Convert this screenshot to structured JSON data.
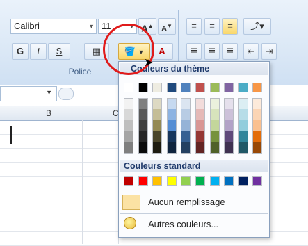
{
  "ribbon": {
    "font_name": "Calibri",
    "font_size": "11",
    "bold": "G",
    "italic": "I",
    "underline": "S",
    "group_label": "Police"
  },
  "sheet": {
    "column_b": "B",
    "column_c": "C"
  },
  "popup": {
    "theme_header": "Couleurs du thème",
    "standard_header": "Couleurs standard",
    "no_fill": "Aucun remplissage",
    "more_colors": "Autres couleurs...",
    "theme_top_row": [
      "#ffffff",
      "#000000",
      "#eeece1",
      "#1f497d",
      "#4f81bd",
      "#c0504d",
      "#9bbb59",
      "#8064a2",
      "#4bacc6",
      "#f79646"
    ],
    "theme_shades": [
      [
        "#f2f2f2",
        "#d8d8d8",
        "#bfbfbf",
        "#a5a5a5",
        "#7f7f7f"
      ],
      [
        "#7f7f7f",
        "#595959",
        "#3f3f3f",
        "#262626",
        "#0c0c0c"
      ],
      [
        "#ddd9c3",
        "#c4bd97",
        "#938953",
        "#494429",
        "#1d1b10"
      ],
      [
        "#c6d9f0",
        "#8db3e2",
        "#548dd4",
        "#17365d",
        "#0f243e"
      ],
      [
        "#dbe5f1",
        "#b8cce4",
        "#95b3d7",
        "#366092",
        "#244061"
      ],
      [
        "#f2dcdb",
        "#e5b9b7",
        "#d99694",
        "#953734",
        "#632423"
      ],
      [
        "#ebf1dd",
        "#d7e3bc",
        "#c3d69b",
        "#76923c",
        "#4f6128"
      ],
      [
        "#e5e0ec",
        "#ccc1d9",
        "#b2a2c7",
        "#5f497a",
        "#3f3151"
      ],
      [
        "#dbeef3",
        "#b7dde8",
        "#92cddc",
        "#31859b",
        "#205867"
      ],
      [
        "#fdeada",
        "#fbd5b5",
        "#fac08f",
        "#e36c09",
        "#974806"
      ]
    ],
    "standard_colors": [
      "#c00000",
      "#ff0000",
      "#ffc000",
      "#ffff00",
      "#92d050",
      "#00b050",
      "#00b0f0",
      "#0070c0",
      "#002060",
      "#7030a0"
    ]
  }
}
